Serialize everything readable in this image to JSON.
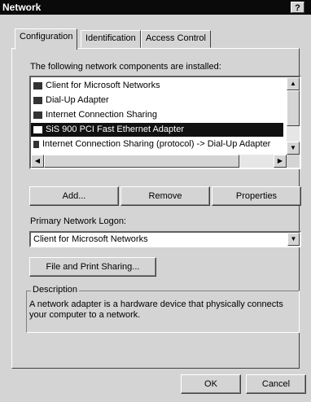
{
  "window": {
    "title": "Network",
    "help_label": "?"
  },
  "tabs": [
    {
      "label": "Configuration",
      "active": true
    },
    {
      "label": "Identification",
      "active": false
    },
    {
      "label": "Access Control",
      "active": false
    }
  ],
  "components": {
    "heading": "The following network components are installed:",
    "items": [
      {
        "label": "Client for Microsoft Networks",
        "icon": "network-client-icon",
        "selected": false
      },
      {
        "label": "Dial-Up Adapter",
        "icon": "network-adapter-icon",
        "selected": false
      },
      {
        "label": "Internet Connection Sharing",
        "icon": "network-adapter-icon",
        "selected": false
      },
      {
        "label": "SiS 900 PCI Fast Ethernet Adapter",
        "icon": "network-adapter-icon",
        "selected": true
      },
      {
        "label": "Internet Connection Sharing (protocol) -> Dial-Up Adapter",
        "icon": "protocol-icon",
        "selected": false
      }
    ]
  },
  "buttons": {
    "add": "Add...",
    "remove": "Remove",
    "properties": "Properties",
    "file_print": "File and Print Sharing...",
    "ok": "OK",
    "cancel": "Cancel"
  },
  "logon": {
    "label": "Primary Network Logon:",
    "selected": "Client for Microsoft Networks"
  },
  "description": {
    "title": "Description",
    "text": "A network adapter is a hardware device that physically connects your computer to a network."
  }
}
